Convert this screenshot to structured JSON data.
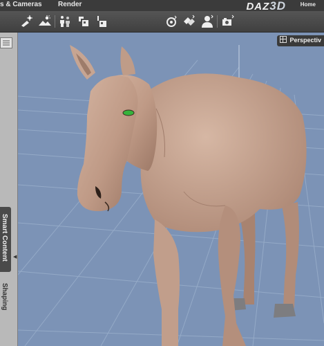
{
  "menubar": {
    "tabs": [
      {
        "label": "s & Cameras",
        "active": false
      },
      {
        "label": "Render",
        "active": false
      }
    ],
    "brand_prefix": "DAZ",
    "brand_suffix": "3D",
    "home_link": "Home"
  },
  "toolbar": {
    "icons": [
      "add-light-icon",
      "environment-icon",
      "figure-icon",
      "prop-load-icon",
      "prop-save-icon",
      "node-rotate-icon",
      "node-pose-icon",
      "figure-user-icon",
      "camera-icon"
    ]
  },
  "left_panel": {
    "tabs": [
      "Smart Content",
      "Shaping"
    ],
    "active_tab": "Smart Content"
  },
  "viewport": {
    "camera_label": "Perspectiv",
    "background_color": "#7c93b6",
    "subject": "horse figure"
  }
}
